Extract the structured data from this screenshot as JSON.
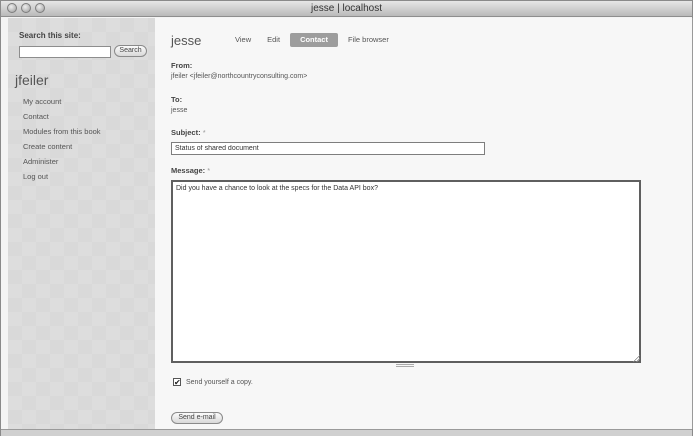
{
  "window": {
    "title": "jesse | localhost"
  },
  "sidebar": {
    "search_label": "Search this site:",
    "search_value": "",
    "search_button": "Search",
    "user_name": "jfeiler",
    "nav_items": [
      {
        "label": "My account"
      },
      {
        "label": "Contact"
      },
      {
        "label": "Modules from this book"
      },
      {
        "label": "Create content"
      },
      {
        "label": "Administer"
      },
      {
        "label": "Log out"
      }
    ]
  },
  "main": {
    "page_title": "jesse",
    "tabs": [
      {
        "label": "View"
      },
      {
        "label": "Edit"
      },
      {
        "label": "Contact",
        "active": true
      },
      {
        "label": "File browser"
      }
    ],
    "from_label": "From:",
    "from_value": "jfeiler <jfeiler@northcountryconsulting.com>",
    "to_label": "To:",
    "to_value": "jesse",
    "subject_label": "Subject:",
    "subject_value": "Status of shared document",
    "message_label": "Message:",
    "message_value": "Did you have a chance to look at the specs for the Data API box?",
    "required_mark": "*",
    "copy_label": "Send yourself a copy.",
    "copy_checked": true,
    "send_button": "Send e-mail"
  },
  "colors": {
    "sidebar_bg": "#d9d9d9",
    "active_tab_bg": "#9d9d9d",
    "content_bg": "#f7f7f7"
  }
}
